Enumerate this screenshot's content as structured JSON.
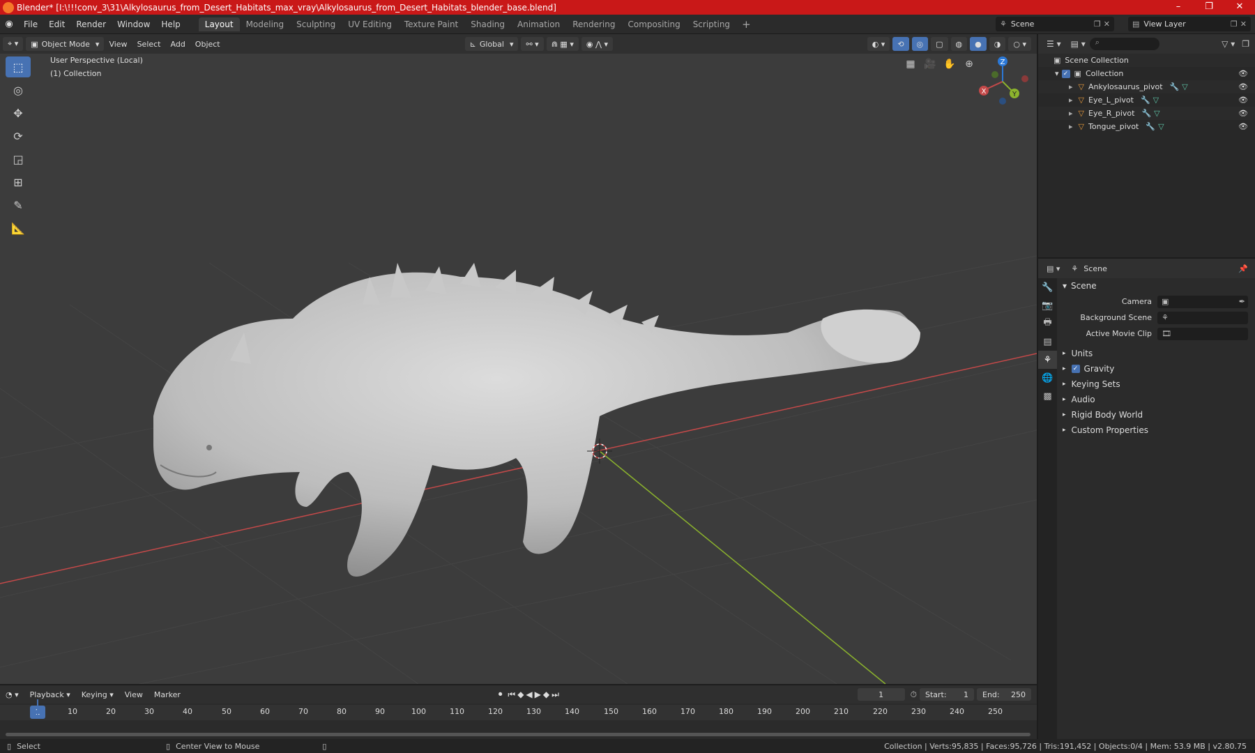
{
  "title": "Blender* [I:\\!!!conv_3\\31\\Alkylosaurus_from_Desert_Habitats_max_vray\\Alkylosaurus_from_Desert_Habitats_blender_base.blend]",
  "window_controls": {
    "minimize": "–",
    "maximize": "❐",
    "close": "✕"
  },
  "menu": [
    "File",
    "Edit",
    "Render",
    "Window",
    "Help"
  ],
  "workspaces": [
    "Layout",
    "Modeling",
    "Sculpting",
    "UV Editing",
    "Texture Paint",
    "Shading",
    "Animation",
    "Rendering",
    "Compositing",
    "Scripting"
  ],
  "workspace_plus": "+",
  "scene_name": "Scene",
  "view_layer": "View Layer",
  "viewport": {
    "mode": "Object Mode",
    "menus": [
      "View",
      "Select",
      "Add",
      "Object"
    ],
    "transform": "Global",
    "info_line1": "User Perspective (Local)",
    "info_line2": "(1) Collection"
  },
  "gizmo": {
    "x": "X",
    "y": "Y",
    "z": "Z"
  },
  "outliner": {
    "root": "Scene Collection",
    "collection": "Collection",
    "items": [
      "Ankylosaurus_pivot",
      "Eye_L_pivot",
      "Eye_R_pivot",
      "Tongue_pivot"
    ]
  },
  "properties": {
    "header": "Scene",
    "panel": "Scene",
    "camera_label": "Camera",
    "bg_scene_label": "Background Scene",
    "movie_clip_label": "Active Movie Clip",
    "subpanels": [
      "Units",
      "Gravity",
      "Keying Sets",
      "Audio",
      "Rigid Body World",
      "Custom Properties"
    ]
  },
  "timeline": {
    "menus": [
      "Playback",
      "Keying",
      "View",
      "Marker"
    ],
    "current_frame": "1",
    "start_label": "Start:",
    "start": "1",
    "end_label": "End:",
    "end": "250",
    "ticks": [
      "1",
      "10",
      "20",
      "30",
      "40",
      "50",
      "60",
      "70",
      "80",
      "90",
      "100",
      "110",
      "120",
      "130",
      "140",
      "150",
      "160",
      "170",
      "180",
      "190",
      "200",
      "210",
      "220",
      "230",
      "240",
      "250"
    ]
  },
  "status": {
    "select": "Select",
    "center": "Center View to Mouse",
    "stats": "Collection | Verts:95,835 | Faces:95,726 | Tris:191,452 | Objects:0/4 | Mem: 53.9 MB | v2.80.75"
  },
  "colors": {
    "accent": "#4772b3",
    "titlebar": "#c91818",
    "x_axis": "#c44949",
    "y_axis": "#8cb42d",
    "object_icon": "#e89a3c"
  }
}
